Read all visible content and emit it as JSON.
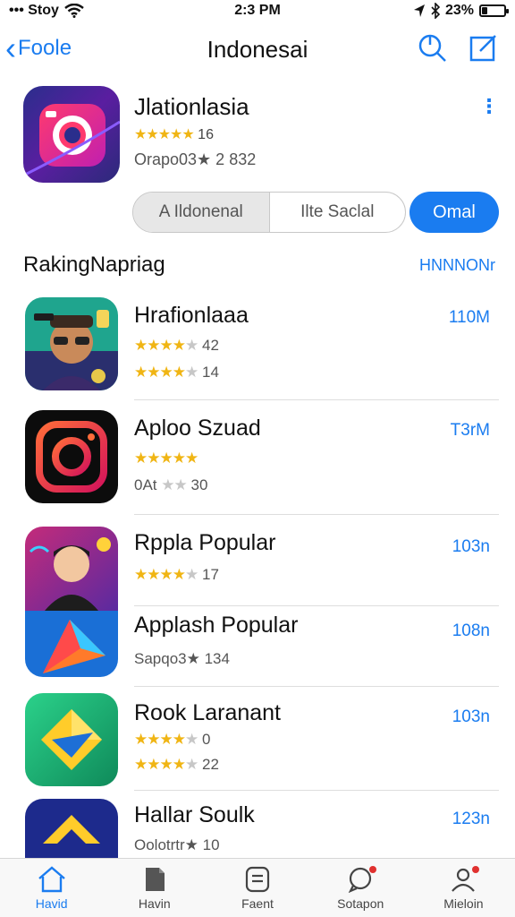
{
  "status_bar": {
    "carrier": "••• Stoy",
    "time": "2:3 PM",
    "battery": "23%",
    "battery_level": 0.23
  },
  "nav": {
    "back_label": "Foole",
    "title": "Indonesai"
  },
  "featured": {
    "name": "Jlationlasia",
    "rating_count": "16",
    "stars": 5,
    "meta": "Orapo03★ 2 832",
    "segments": [
      "A  Ildonenal",
      "Ilte Saclal"
    ],
    "active_segment": 0,
    "open_label": "Omal"
  },
  "section": {
    "title": "RakingNapriag",
    "link": "HNNNONr"
  },
  "apps": [
    {
      "name": "Hrafionlaaa",
      "size": "110M",
      "line2_stars": 4,
      "line2_text": "42",
      "line3_stars": 4,
      "line3_text": "14"
    },
    {
      "name": "Aploo Szuad",
      "size": "T3rM",
      "line2_stars": 5,
      "line2_text": "",
      "line3_text": "0At",
      "line3_stars": 2,
      "line3_suffix": "30"
    },
    {
      "name": "Rppla Popular",
      "size": "103n",
      "line2_stars": 4,
      "line2_text": "17"
    },
    {
      "name": "Applash Popular",
      "size": "108n",
      "line2_text": "Sapqo3★ 134"
    },
    {
      "name": "Rook Laranant",
      "size": "103n",
      "line2_stars": 4,
      "line2_text": "0",
      "line3_stars": 4,
      "line3_text": "22"
    },
    {
      "name": "Hallar Soulk",
      "size": "123n",
      "line2_text": "Oolotrtr★ 10"
    }
  ],
  "tabs": [
    {
      "label": "Havid",
      "icon": "house-icon",
      "active": true
    },
    {
      "label": "Havin",
      "icon": "document-icon",
      "active": false
    },
    {
      "label": "Faent",
      "icon": "list-icon",
      "active": false
    },
    {
      "label": "Sotapon",
      "icon": "chat-icon",
      "active": false,
      "badge": true
    },
    {
      "label": "Mieloin",
      "icon": "person-icon",
      "active": false,
      "badge": true
    }
  ],
  "colors": {
    "accent": "#1a7cf0",
    "star": "#f0b514",
    "badge": "#e0312f"
  }
}
